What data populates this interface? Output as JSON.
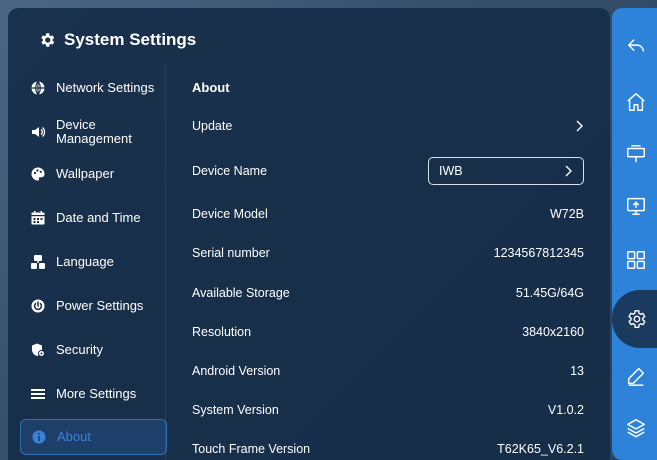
{
  "header": {
    "title": "System Settings",
    "icon": "gear-icon"
  },
  "sidebar": {
    "items": [
      {
        "label": "Network Settings",
        "icon": "globe-icon"
      },
      {
        "label": "Device Management",
        "icon": "speaker-icon"
      },
      {
        "label": "Wallpaper",
        "icon": "palette-icon"
      },
      {
        "label": "Date and Time",
        "icon": "calendar-icon"
      },
      {
        "label": "Language",
        "icon": "language-icon"
      },
      {
        "label": "Power Settings",
        "icon": "power-icon"
      },
      {
        "label": "Security",
        "icon": "security-icon"
      },
      {
        "label": "More Settings",
        "icon": "menu-icon"
      },
      {
        "label": "About",
        "icon": "info-icon",
        "active": true
      }
    ]
  },
  "about": {
    "title": "About",
    "update_label": "Update",
    "device_name": {
      "label": "Device Name",
      "value": "IWB"
    },
    "rows": [
      {
        "label": "Device Model",
        "value": "W72B"
      },
      {
        "label": "Serial number",
        "value": "1234567812345"
      },
      {
        "label": "Available Storage",
        "value": "51.45G/64G"
      },
      {
        "label": "Resolution",
        "value": "3840x2160"
      },
      {
        "label": "Android Version",
        "value": "13"
      },
      {
        "label": "System Version",
        "value": "V1.0.2"
      },
      {
        "label": "Touch Frame Version",
        "value": "T62K65_V6.2.1"
      }
    ]
  },
  "rail": {
    "items": [
      "back-icon",
      "home-icon",
      "display-stand-icon",
      "screen-share-icon",
      "apps-grid-icon",
      "settings-icon",
      "pen-icon",
      "layers-icon"
    ],
    "active": "settings-icon"
  },
  "colors": {
    "panel": "#162c48",
    "rail": "#2d82d9",
    "active_text": "#3b82d6"
  }
}
